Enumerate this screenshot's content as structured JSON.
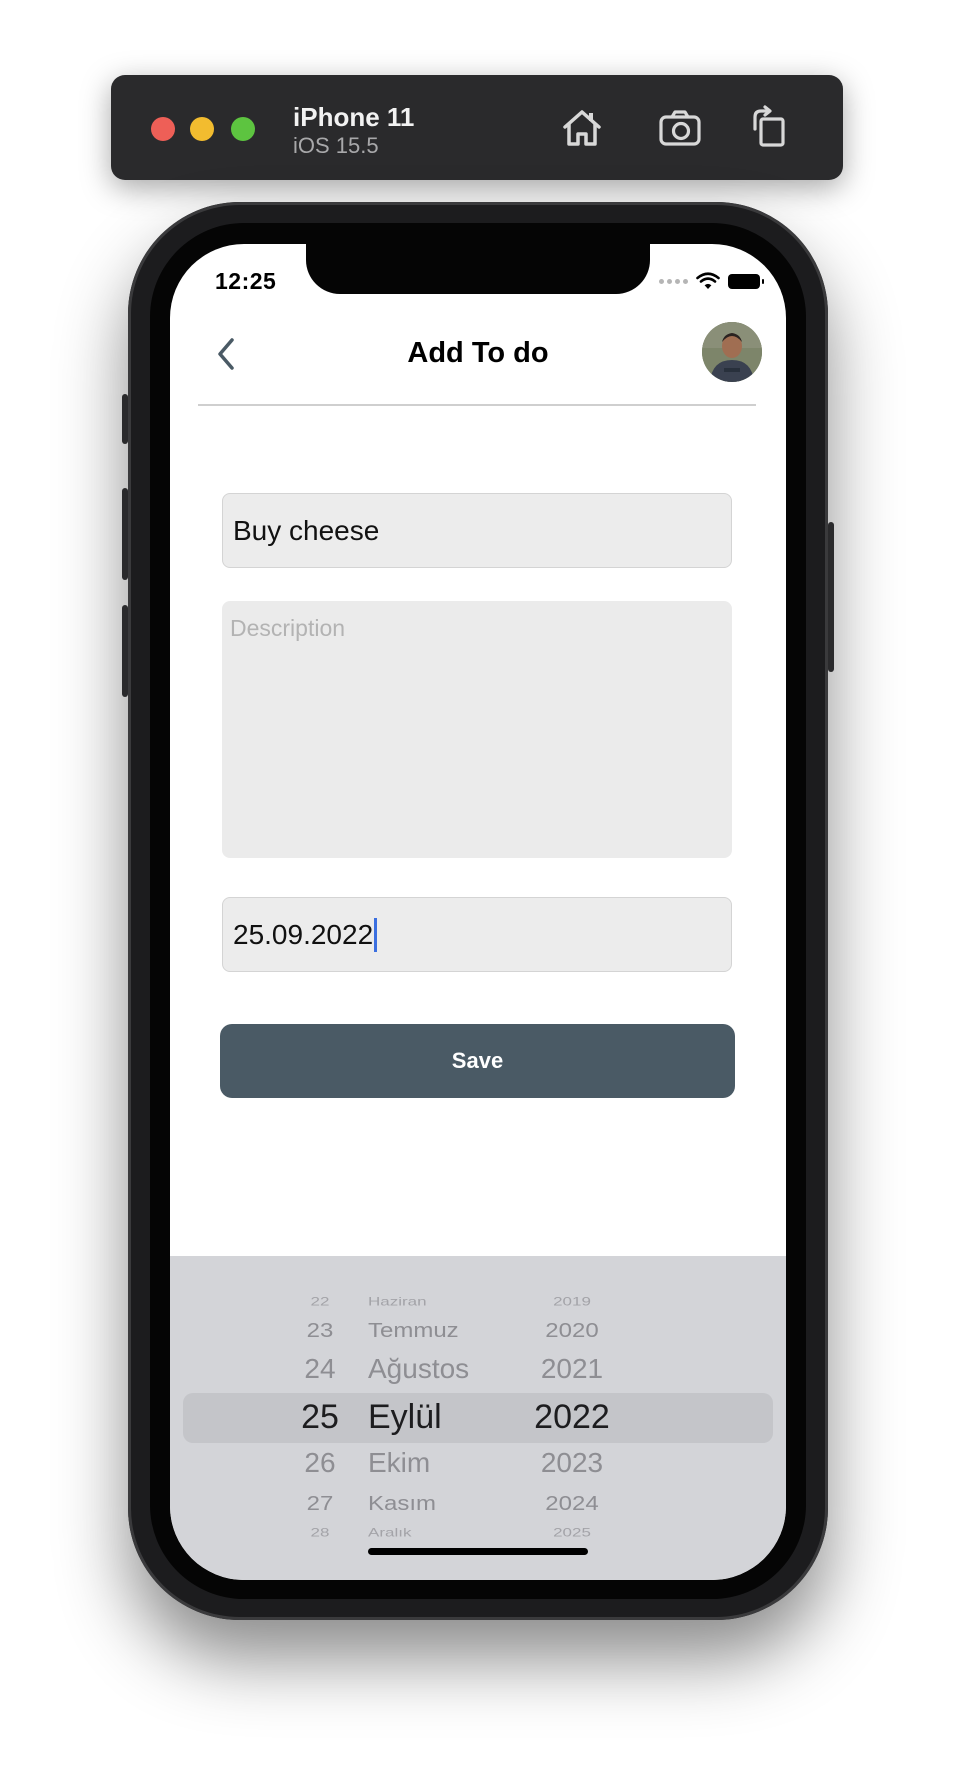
{
  "simulator": {
    "device_name": "iPhone 11",
    "os_version": "iOS 15.5",
    "icons": [
      "home-icon",
      "screenshot-icon",
      "rotate-icon"
    ]
  },
  "status_bar": {
    "time": "12:25"
  },
  "nav": {
    "title": "Add To do",
    "back_icon": "chevron-left-icon"
  },
  "form": {
    "title_value": "Buy cheese",
    "description_placeholder": "Description",
    "date_value": "25.09.2022",
    "save_label": "Save"
  },
  "colors": {
    "save_button": "#4a5a65",
    "field_background": "#ececec",
    "picker_background": "#d3d4d8"
  },
  "date_picker": {
    "days": [
      "22",
      "23",
      "24",
      "25",
      "26",
      "27",
      "28"
    ],
    "months": [
      "Haziran",
      "Temmuz",
      "Ağustos",
      "Eylül",
      "Ekim",
      "Kasım",
      "Aralık"
    ],
    "years": [
      "2019",
      "2020",
      "2021",
      "2022",
      "2023",
      "2024",
      "2025"
    ],
    "selected": {
      "day": "25",
      "month": "Eylül",
      "year": "2022"
    }
  }
}
